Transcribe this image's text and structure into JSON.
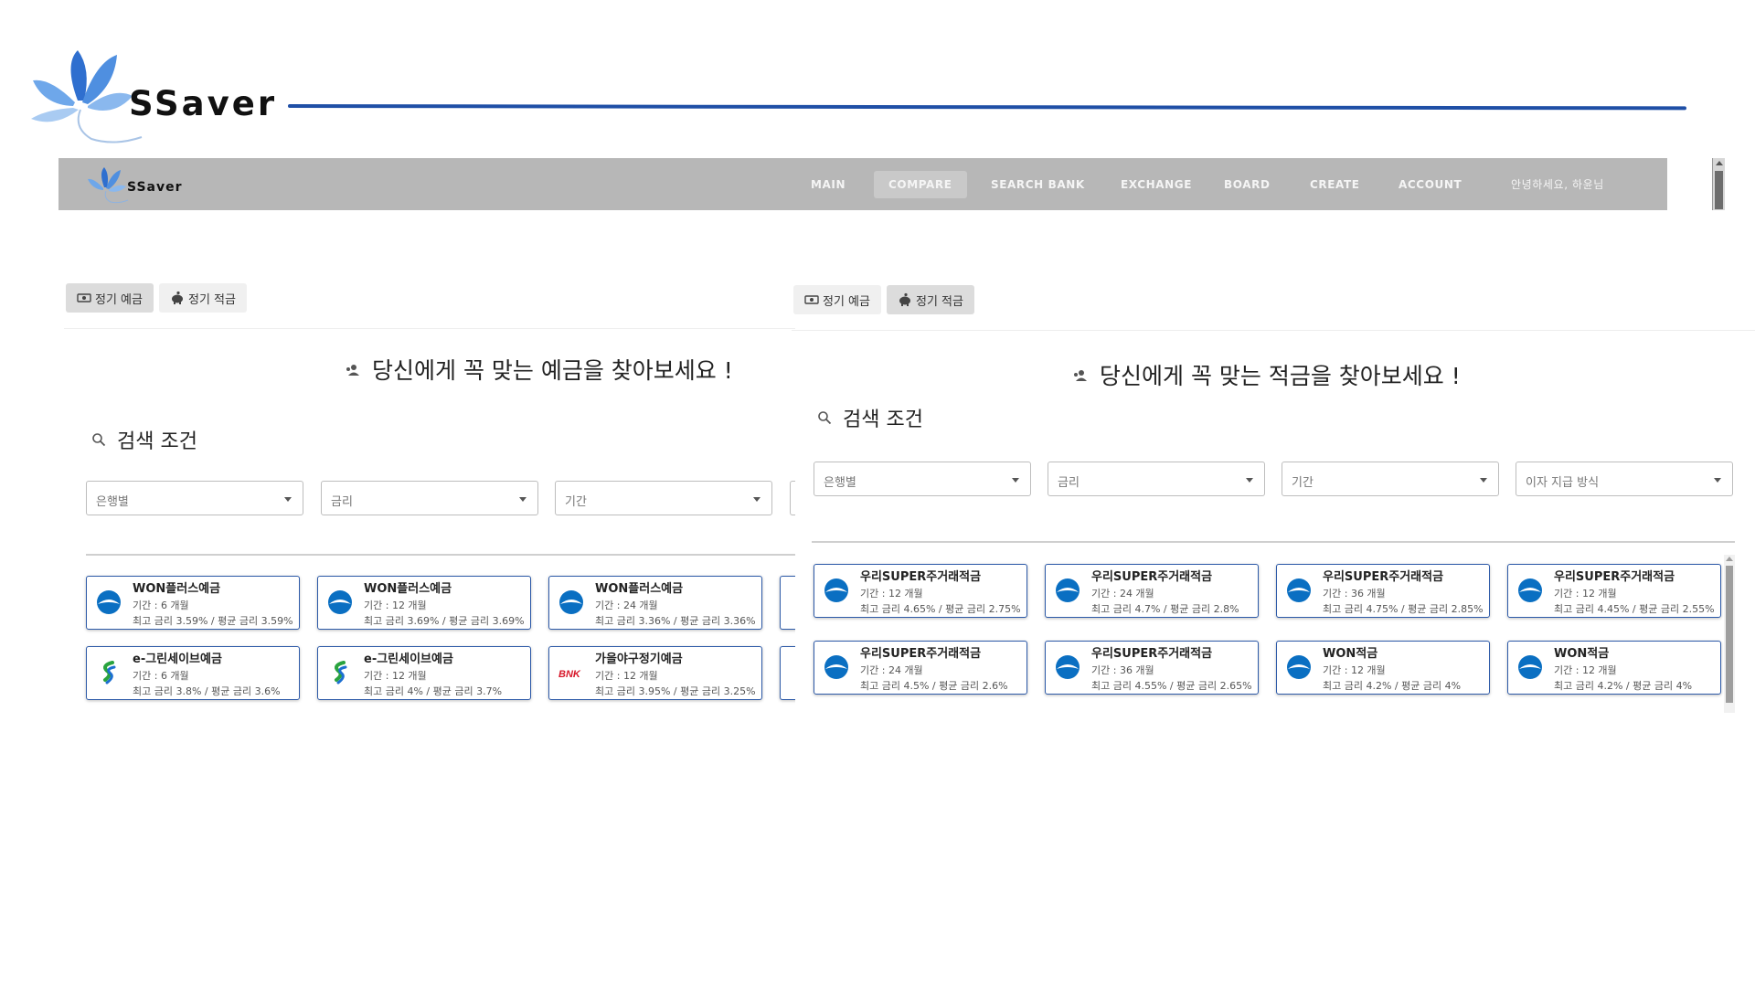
{
  "brand": {
    "name": "SSaver"
  },
  "nav": {
    "brand": "SSaver",
    "items": [
      {
        "label": "MAIN",
        "active": false
      },
      {
        "label": "COMPARE",
        "active": true
      },
      {
        "label": "SEARCH BANK",
        "active": false
      },
      {
        "label": "EXCHANGE",
        "active": false
      },
      {
        "label": "BOARD",
        "active": false
      },
      {
        "label": "CREATE",
        "active": false
      },
      {
        "label": "ACCOUNT",
        "active": false
      }
    ],
    "greeting": "안녕하세요, 하윤님"
  },
  "deposit": {
    "tabs": [
      {
        "label": "정기 예금",
        "icon": "money-icon",
        "active": true
      },
      {
        "label": "정기 적금",
        "icon": "piggy-bank-icon",
        "active": false
      }
    ],
    "headline": "당신에게 꼭 맞는 예금을 찾아보세요 !",
    "search_title": "검색 조건",
    "filters": [
      "은행별",
      "금리",
      "기간"
    ],
    "products": [
      {
        "name": "WON플러스예금",
        "period": "기간 : 6 개월",
        "rate": "최고 금리 3.59% / 평균 금리 3.59%",
        "bank_icon": "woori-bank-icon"
      },
      {
        "name": "WON플러스예금",
        "period": "기간 : 12 개월",
        "rate": "최고 금리 3.69% / 평균 금리 3.69%",
        "bank_icon": "woori-bank-icon"
      },
      {
        "name": "WON플러스예금",
        "period": "기간 : 24 개월",
        "rate": "최고 금리 3.36% / 평균 금리 3.36%",
        "bank_icon": "woori-bank-icon"
      },
      {
        "name": "e-그린세이브예금",
        "period": "기간 : 6 개월",
        "rate": "최고 금리 3.8% / 평균 금리 3.6%",
        "bank_icon": "sc-bank-icon"
      },
      {
        "name": "e-그린세이브예금",
        "period": "기간 : 12 개월",
        "rate": "최고 금리 4% / 평균 금리 3.7%",
        "bank_icon": "sc-bank-icon"
      },
      {
        "name": "가을야구정기예금",
        "period": "기간 : 12 개월",
        "rate": "최고 금리 3.95% / 평균 금리 3.25%",
        "bank_icon": "bnk-bank-icon",
        "bank_text": "BNK"
      }
    ]
  },
  "savings": {
    "tabs": [
      {
        "label": "정기 예금",
        "icon": "money-icon",
        "active": false
      },
      {
        "label": "정기 적금",
        "icon": "piggy-bank-icon",
        "active": true
      }
    ],
    "headline": "당신에게 꼭 맞는 적금을 찾아보세요 !",
    "search_title": "검색 조건",
    "filters": [
      "은행별",
      "금리",
      "기간",
      "이자 지급 방식"
    ],
    "products": [
      {
        "name": "우리SUPER주거래적금",
        "period": "기간 : 12 개월",
        "rate": "최고 금리 4.65% / 평균 금리 2.75%",
        "bank_icon": "woori-bank-icon"
      },
      {
        "name": "우리SUPER주거래적금",
        "period": "기간 : 24 개월",
        "rate": "최고 금리 4.7% / 평균 금리 2.8%",
        "bank_icon": "woori-bank-icon"
      },
      {
        "name": "우리SUPER주거래적금",
        "period": "기간 : 36 개월",
        "rate": "최고 금리 4.75% / 평균 금리 2.85%",
        "bank_icon": "woori-bank-icon"
      },
      {
        "name": "우리SUPER주거래적금",
        "period": "기간 : 12 개월",
        "rate": "최고 금리 4.45% / 평균 금리 2.55%",
        "bank_icon": "woori-bank-icon"
      },
      {
        "name": "우리SUPER주거래적금",
        "period": "기간 : 24 개월",
        "rate": "최고 금리 4.5% / 평균 금리 2.6%",
        "bank_icon": "woori-bank-icon"
      },
      {
        "name": "우리SUPER주거래적금",
        "period": "기간 : 36 개월",
        "rate": "최고 금리 4.55% / 평균 금리 2.65%",
        "bank_icon": "woori-bank-icon"
      },
      {
        "name": "WON적금",
        "period": "기간 : 12 개월",
        "rate": "최고 금리 4.2% / 평균 금리 4%",
        "bank_icon": "woori-bank-icon"
      },
      {
        "name": "WON적금",
        "period": "기간 : 12 개월",
        "rate": "최고 금리 4.2% / 평균 금리 4%",
        "bank_icon": "woori-bank-icon"
      }
    ]
  },
  "colors": {
    "accent": "#1f4fa6",
    "card_border": "#2d5aa8",
    "navbar": "#b7b7b7",
    "woori_blue": "#0a6fc2",
    "bnk_red": "#d7182a",
    "sc_green": "#2aa33f",
    "sc_blue": "#1c6fd1"
  }
}
